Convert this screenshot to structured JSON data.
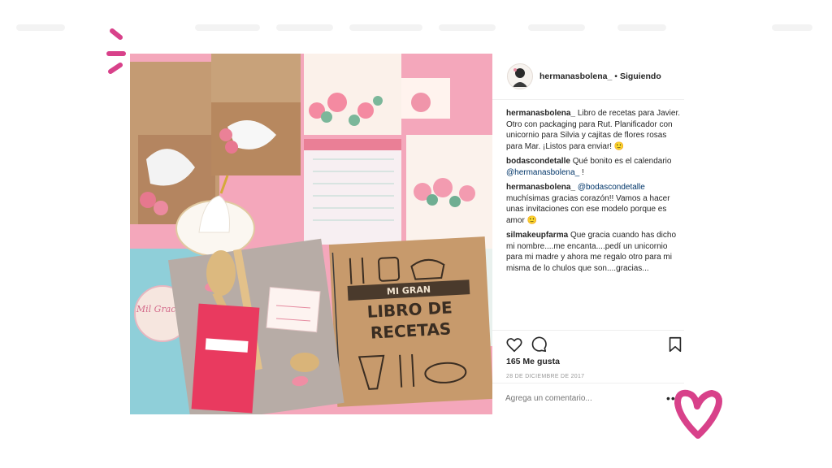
{
  "post": {
    "username": "hermanasbolena_",
    "separator": "•",
    "follow_label": "Siguiendo",
    "likes": "165 Me gusta",
    "date": "28 DE DICIEMBRE DE 2017",
    "comment_placeholder": "Agrega un comentario...",
    "more_label": "••"
  },
  "comments": [
    {
      "user": "hermanasbolena_",
      "text": "Libro de recetas para Javier. Otro con packaging para Rut. Planificador con unicornio para Silvia y cajitas de flores rosas para Mar. ¡Listos para enviar! 🙂"
    },
    {
      "user": "bodascondetalle",
      "text_before": "Qué bonito es el calendario",
      "mention": "@hermanasbolena_",
      "text_after": "!"
    },
    {
      "user": "hermanasbolena_",
      "mention": "@bodascondetalle",
      "text": "muchísimas gracias corazón!! Vamos a hacer unas invitaciones con ese modelo porque es amor 🙂"
    },
    {
      "user": "silmakeupfarma",
      "text": "Que gracia cuando has dicho mi nombre....me encanta....pedí un unicornio para mi madre y ahora me regalo otro para mi misma de lo chulos que son....gracias..."
    }
  ],
  "image": {
    "notebook_line1": "MI GRAN",
    "notebook_line2": "LIBRO DE",
    "notebook_line3": "RECETAS",
    "tag_text": "PARA:\nDE:",
    "sticker_text": "Mil Gracias"
  },
  "icons": [
    "heart-icon",
    "comment-icon",
    "bookmark-icon"
  ],
  "colors": {
    "accent_pink": "#d8418a",
    "mention": "#003569",
    "muted": "#999999"
  }
}
